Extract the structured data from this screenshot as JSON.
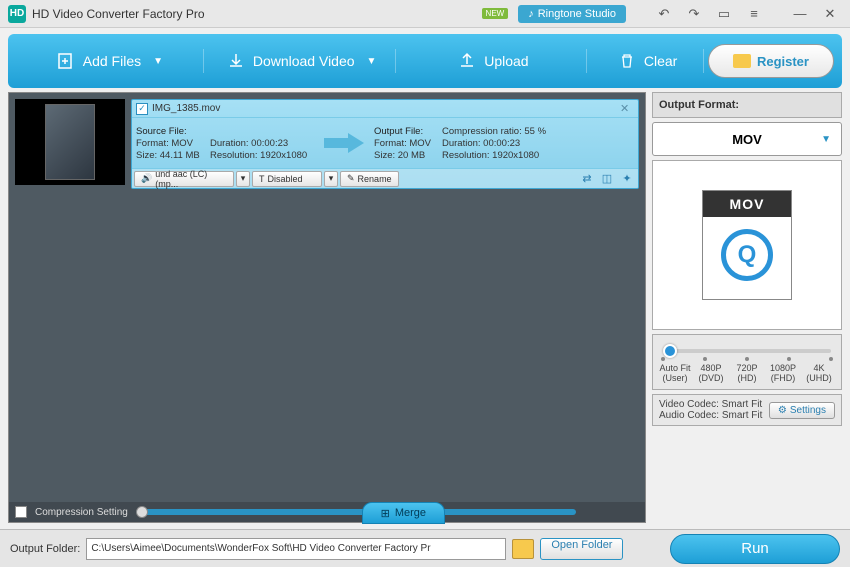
{
  "titlebar": {
    "app_title": "HD Video Converter Factory Pro",
    "new_badge": "NEW",
    "ringtone": "Ringtone Studio"
  },
  "toolbar": {
    "add_files": "Add Files",
    "download_video": "Download Video",
    "upload": "Upload",
    "clear": "Clear",
    "register": "Register"
  },
  "file": {
    "name": "IMG_1385.mov",
    "source": {
      "header": "Source File:",
      "format": "Format: MOV",
      "size": "Size: 44.11 MB",
      "duration": "Duration: 00:00:23",
      "resolution": "Resolution: 1920x1080"
    },
    "output": {
      "header": "Output File:",
      "format": "Format: MOV",
      "size": "Size: 20 MB",
      "compression": "Compression ratio: 55 %",
      "duration": "Duration: 00:00:23",
      "resolution": "Resolution: 1920x1080"
    },
    "audio_track": "und aac (LC) (mp...",
    "subtitle": "Disabled",
    "rename": "Rename"
  },
  "output_panel": {
    "header": "Output Format:",
    "format": "MOV",
    "icon_label": "MOV",
    "resolutions": [
      {
        "top": "Auto Fit",
        "bottom": "(User)"
      },
      {
        "top": "480P",
        "bottom": "(DVD)"
      },
      {
        "top": "720P",
        "bottom": "(HD)"
      },
      {
        "top": "1080P",
        "bottom": "(FHD)"
      },
      {
        "top": "4K",
        "bottom": "(UHD)"
      }
    ],
    "video_codec": "Video Codec: Smart Fit",
    "audio_codec": "Audio Codec: Smart Fit",
    "settings": "Settings"
  },
  "compression": {
    "label": "Compression Setting"
  },
  "merge": "Merge",
  "bottom": {
    "output_folder_label": "Output Folder:",
    "path": "C:\\Users\\Aimee\\Documents\\WonderFox Soft\\HD Video Converter Factory Pr",
    "open_folder": "Open Folder",
    "run": "Run"
  }
}
